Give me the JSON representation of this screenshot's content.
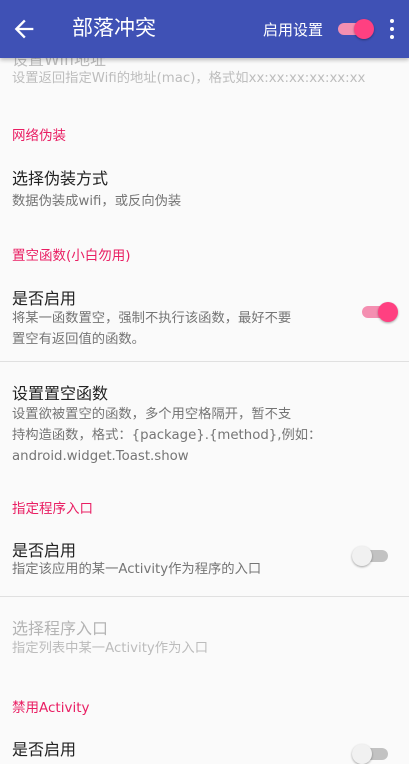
{
  "appbar": {
    "title": "部落冲突",
    "switch_label": "启用设置",
    "switch_on": true
  },
  "items": {
    "wifi_summary": "设置返回指定Wifi的地址(mac)，格式如xx:xx:xx:xx:xx:xx",
    "cat_disguise": "网络伪装",
    "disguise_title": "选择伪装方式",
    "disguise_summary": "数据伪装成wifi，或反向伪装",
    "cat_null": "置空函数(小白勿用)",
    "null_enable_title": "是否启用",
    "null_enable_summary": [
      "将某一函数置空，强制不执行该函数，最好不要",
      "置空有返回值的函数。"
    ],
    "null_enable_on": true,
    "null_set_title": "设置置空函数",
    "null_set_summary": [
      "设置欲被置空的函数，多个用空格隔开，暂不支",
      "持构造函数，格式：{package}.{method},例如：",
      "android.widget.Toast.show"
    ],
    "cat_entry": "指定程序入口",
    "entry_enable_title": "是否启用",
    "entry_enable_summary": "指定该应用的某一Activity作为程序的入口",
    "entry_enable_on": false,
    "entry_select_title": "选择程序入口",
    "entry_select_summary": "指定列表中某一Activity作为入口",
    "cat_activity": "禁用Activity",
    "act_enable_title": "是否启用",
    "act_enable_on": false
  },
  "colors": {
    "primary": "#3f51b5",
    "accent": "#ff4081",
    "category": "#e91e63"
  }
}
